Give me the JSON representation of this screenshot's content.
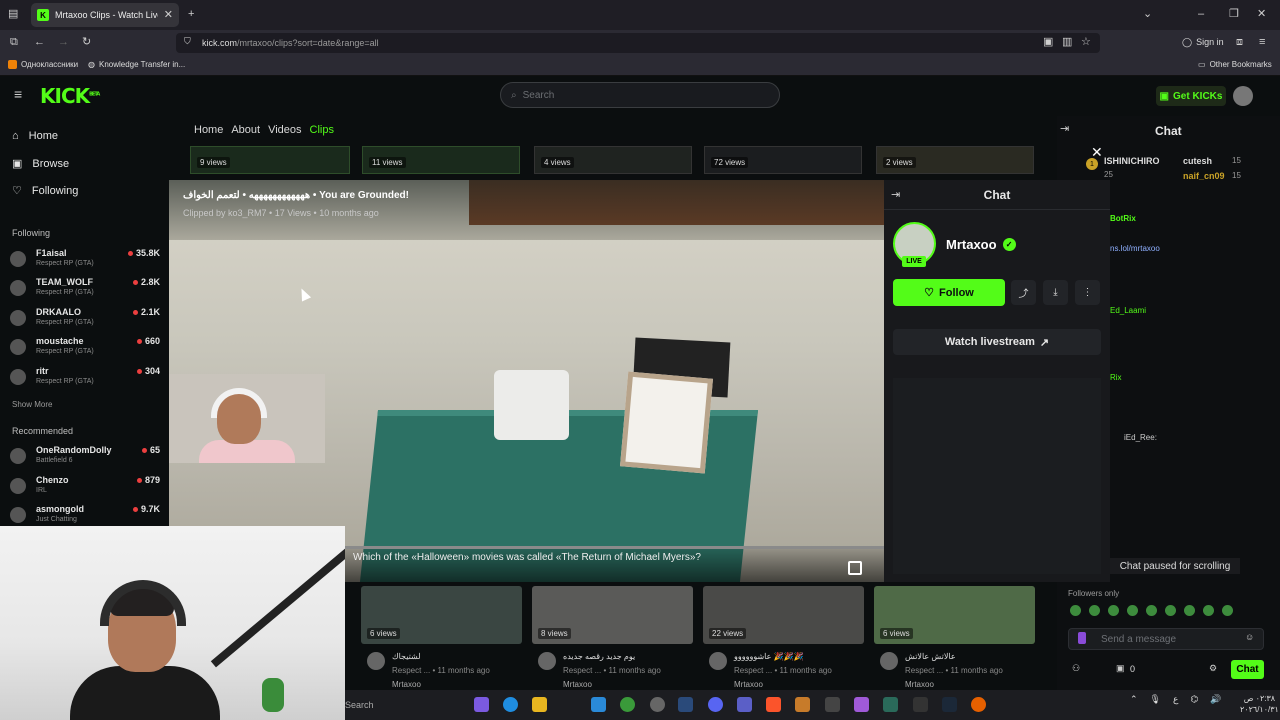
{
  "browser": {
    "tab_title": "Mrtaxoo Clips - Watch Live",
    "url_host": "kick.com",
    "url_path": "/mrtaxoo/clips?sort=date&range=all",
    "sign_in": "Sign in",
    "bookmarks": [
      "Одноклассники",
      "Knowledge Transfer in..."
    ],
    "other_bookmarks": "Other Bookmarks"
  },
  "header": {
    "logo": "KICK",
    "logo_sup": "BETA",
    "search_placeholder": "Search",
    "get_kicks": "Get KICKs",
    "accent": "#53fc18"
  },
  "sidebar": {
    "nav": [
      {
        "label": "Home",
        "icon": "home-icon"
      },
      {
        "label": "Browse",
        "icon": "browse-icon"
      },
      {
        "label": "Following",
        "icon": "heart-icon"
      }
    ],
    "following_title": "Following",
    "following": [
      {
        "name": "F1aisal",
        "game": "Respect RP (GTA)",
        "count": "35.8K"
      },
      {
        "name": "TEAM_WOLF",
        "game": "Respect RP (GTA)",
        "count": "2.8K"
      },
      {
        "name": "DRKAALO",
        "game": "Respect RP (GTA)",
        "count": "2.1K"
      },
      {
        "name": "moustache",
        "game": "Respect RP (GTA)",
        "count": "660"
      },
      {
        "name": "ritr",
        "game": "Respect RP (GTA)",
        "count": "304"
      }
    ],
    "show_more": "Show More",
    "recommended_title": "Recommended",
    "recommended": [
      {
        "name": "OneRandomDolly",
        "game": "Battlefield 6",
        "count": "65"
      },
      {
        "name": "Chenzo",
        "game": "IRL",
        "count": "879"
      },
      {
        "name": "asmongold",
        "game": "Just Chatting",
        "count": "9.7K"
      }
    ]
  },
  "channel_tabs": [
    "Home",
    "About",
    "Videos",
    "Clips"
  ],
  "top_clip_views": [
    "9 views",
    "11 views",
    "4 views",
    "72 views",
    "2 views"
  ],
  "modal": {
    "title": "ههههههههههههه • لتعمم الخواف • You are Grounded!",
    "subtitle": "Clipped by ko3_RM7 • 17 Views • 10 months ago",
    "caption": "Which of the «Halloween» movies was called «The Return of Michael Myers»?",
    "chat_title": "Chat",
    "channel_name": "Mrtaxoo",
    "live_badge": "LIVE",
    "follow": "Follow",
    "watch_livestream": "Watch livestream"
  },
  "right_chat": {
    "title": "Chat",
    "top_users": [
      {
        "name": "ISHINICHIRO",
        "num": "25"
      },
      {
        "name": "cutesh",
        "num": "15"
      },
      {
        "name": "naif_cn09",
        "num": "15"
      }
    ],
    "lines": [
      "BotRix",
      "ns.lol/mrtaxoo",
      "Ed_Laami",
      "Rix",
      "iEd_Ree:"
    ],
    "paused": "Chat paused for scrolling",
    "followers_only": "Followers only",
    "placeholder": "Send a message",
    "counter": "0",
    "send": "Chat"
  },
  "bottom_clips": [
    {
      "views": "6 views",
      "title": "لشتيجاك",
      "sub": "Respect ... • 11 months ago",
      "channel": "Mrtaxoo"
    },
    {
      "views": "8 views",
      "title": "يوم جديد رقصه جديده",
      "sub": "Respect ... • 11 months ago",
      "channel": "Mrtaxoo"
    },
    {
      "views": "22 views",
      "title": "عاشوووووو 🎉🎉🎉",
      "sub": "Respect ... • 11 months ago",
      "channel": "Mrtaxoo"
    },
    {
      "views": "6 views",
      "title": "عالاتش عالاتش",
      "sub": "Respect ... • 11 months ago",
      "channel": "Mrtaxoo"
    }
  ],
  "taskbar": {
    "search": "Search",
    "clock_time": "٠٢:٣٨ ص",
    "clock_date": "٢٠٢٦/١٠/٣١"
  }
}
